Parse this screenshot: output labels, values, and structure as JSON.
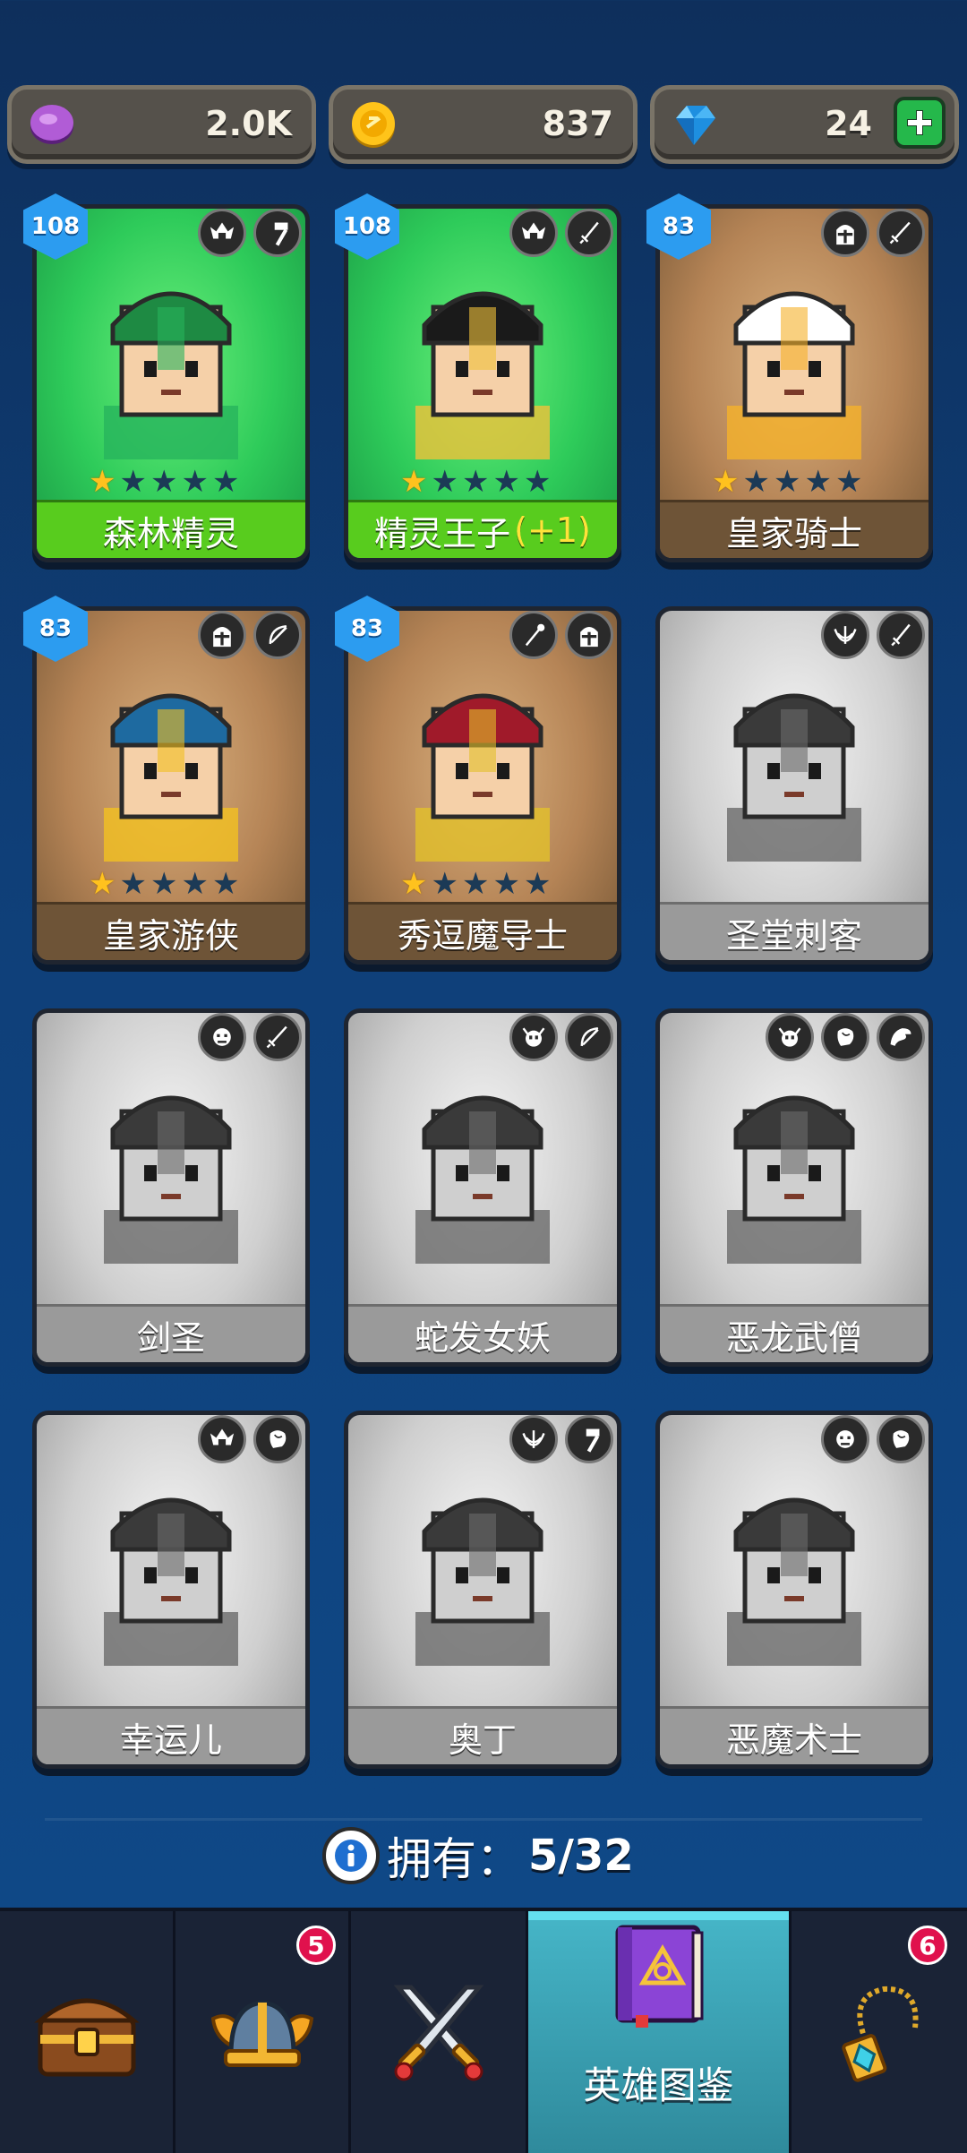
{
  "currencies": [
    {
      "icon": "purple-gem-icon",
      "value": "2.0K"
    },
    {
      "icon": "gold-coin-icon",
      "value": "837"
    },
    {
      "icon": "blue-diamond-icon",
      "value": "24"
    }
  ],
  "heroes": [
    {
      "name": "森林精灵",
      "bonus": "",
      "level": "108",
      "stars": 1,
      "theme": "green",
      "classes": [
        "elf-icon",
        "hammer-icon"
      ]
    },
    {
      "name": "精灵王子",
      "bonus": "(+1)",
      "level": "108",
      "stars": 1,
      "theme": "green",
      "classes": [
        "elf-icon",
        "dagger-icon"
      ]
    },
    {
      "name": "皇家骑士",
      "bonus": "",
      "level": "83",
      "stars": 1,
      "theme": "brown",
      "classes": [
        "helmet-icon",
        "sword-icon"
      ]
    },
    {
      "name": "皇家游侠",
      "bonus": "",
      "level": "83",
      "stars": 1,
      "theme": "brown",
      "classes": [
        "helmet-icon",
        "bow-icon"
      ]
    },
    {
      "name": "秀逗魔导士",
      "bonus": "",
      "level": "83",
      "stars": 1,
      "theme": "brown",
      "classes": [
        "staff-icon",
        "helmet-icon"
      ]
    },
    {
      "name": "圣堂刺客",
      "bonus": "",
      "level": "",
      "stars": 0,
      "theme": "gray",
      "classes": [
        "winged-icon",
        "dagger-icon"
      ]
    },
    {
      "name": "剑圣",
      "bonus": "",
      "level": "",
      "stars": 0,
      "theme": "gray",
      "classes": [
        "orc-icon",
        "sword-icon"
      ]
    },
    {
      "name": "蛇发女妖",
      "bonus": "",
      "level": "",
      "stars": 0,
      "theme": "gray",
      "classes": [
        "demon-skull-icon",
        "bow-icon"
      ]
    },
    {
      "name": "恶龙武僧",
      "bonus": "",
      "level": "",
      "stars": 0,
      "theme": "gray",
      "classes": [
        "demon-skull-icon",
        "fist-icon",
        "dragon-icon"
      ]
    },
    {
      "name": "幸运儿",
      "bonus": "",
      "level": "",
      "stars": 0,
      "theme": "gray",
      "classes": [
        "elf-icon",
        "fist-icon"
      ]
    },
    {
      "name": "奥丁",
      "bonus": "",
      "level": "",
      "stars": 0,
      "theme": "gray",
      "classes": [
        "winged-icon",
        "hammer-icon"
      ]
    },
    {
      "name": "恶魔术士",
      "bonus": "",
      "level": "",
      "stars": 0,
      "theme": "gray",
      "classes": [
        "orc-icon",
        "fist-icon"
      ]
    }
  ],
  "owned": {
    "label": "拥有：",
    "count": "5/32"
  },
  "nav": {
    "tabs": [
      {
        "icon": "treasure-chest-icon",
        "label": "",
        "badge": ""
      },
      {
        "icon": "winged-helmet-icon",
        "label": "",
        "badge": "5"
      },
      {
        "icon": "crossed-swords-icon",
        "label": "",
        "badge": ""
      },
      {
        "icon": "spell-book-icon",
        "label": "英雄图鉴",
        "badge": ""
      },
      {
        "icon": "amulet-icon",
        "label": "",
        "badge": "6"
      }
    ]
  }
}
